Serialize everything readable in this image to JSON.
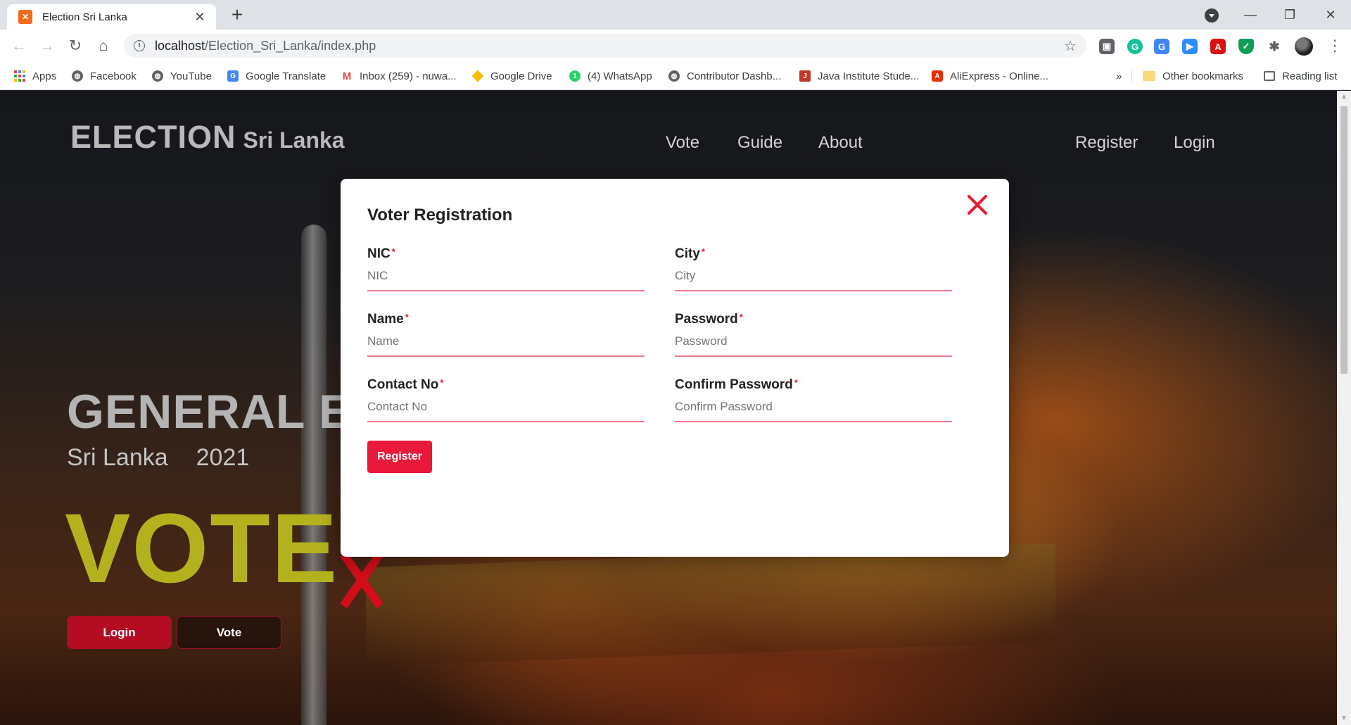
{
  "browser": {
    "tab_title": "Election Sri Lanka",
    "url_host": "localhost",
    "url_path": "/Election_Sri_Lanka/index.php",
    "bookmarks": {
      "apps": "Apps",
      "facebook": "Facebook",
      "youtube": "YouTube",
      "google_translate": "Google Translate",
      "inbox": "Inbox (259) - nuwa...",
      "google_drive": "Google Drive",
      "whatsapp": "(4) WhatsApp",
      "contributor": "Contributor Dashb...",
      "java_institute": "Java Institute Stude...",
      "aliexpress": "AliExpress - Online...",
      "overflow": "»",
      "other_bookmarks": "Other bookmarks",
      "reading_list": "Reading list"
    }
  },
  "site": {
    "logo_main": "ELECTION",
    "logo_sub": "Sri Lanka",
    "nav": {
      "vote": "Vote",
      "guide": "Guide",
      "about": "About",
      "register": "Register",
      "login": "Login"
    },
    "hero": {
      "title": "GENERAL ELECTION",
      "country": "Sri Lanka",
      "year": "2021",
      "vote_text": "VOTE",
      "login_button": "Login",
      "vote_button": "Vote"
    }
  },
  "modal": {
    "title": "Voter Registration",
    "required_mark": "*",
    "fields": {
      "nic": {
        "label": "NIC",
        "placeholder": "NIC",
        "value": ""
      },
      "city": {
        "label": "City",
        "placeholder": "City",
        "value": ""
      },
      "name": {
        "label": "Name",
        "placeholder": "Name",
        "value": ""
      },
      "password": {
        "label": "Password",
        "placeholder": "Password",
        "value": ""
      },
      "contact": {
        "label": "Contact No",
        "placeholder": "Contact No",
        "value": ""
      },
      "confirm_password": {
        "label": "Confirm Password",
        "placeholder": "Confirm Password",
        "value": ""
      }
    },
    "register_button": "Register"
  },
  "colors": {
    "accent_red": "#e8193a",
    "input_underline": "#f07a91",
    "vote_yellow": "#b3b21e",
    "hero_login_bg": "#b30c23"
  }
}
